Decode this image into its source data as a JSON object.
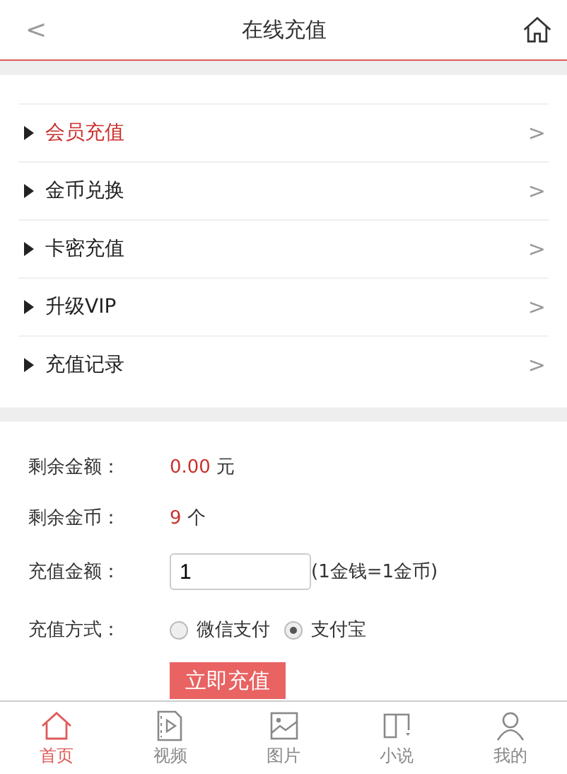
{
  "header": {
    "back": "<",
    "title": "在线充值"
  },
  "menu": [
    {
      "label": "会员充值",
      "selected": true,
      "chevron": ">"
    },
    {
      "label": "金币兑换",
      "selected": false,
      "chevron": ">"
    },
    {
      "label": "卡密充值",
      "selected": false,
      "chevron": ">"
    },
    {
      "label": "升级VIP",
      "selected": false,
      "chevron": ">"
    },
    {
      "label": "充值记录",
      "selected": false,
      "chevron": ">"
    }
  ],
  "balance": {
    "label": "剩余金额：",
    "value": "0.00",
    "unit": "元"
  },
  "coins": {
    "label": "剩余金币：",
    "value": "9",
    "unit": "个"
  },
  "amount": {
    "label": "充值金额：",
    "value": "1",
    "note": "(1金钱=1金币)"
  },
  "method": {
    "label": "充值方式：",
    "options": [
      {
        "label": "微信支付",
        "selected": false
      },
      {
        "label": "支付宝",
        "selected": true
      }
    ]
  },
  "submit": "立即充值",
  "nav": [
    {
      "kind": "home",
      "label": "首页",
      "selected": true
    },
    {
      "kind": "video",
      "label": "视频",
      "selected": false
    },
    {
      "kind": "image",
      "label": "图片",
      "selected": false
    },
    {
      "kind": "book",
      "label": "小说",
      "selected": false
    },
    {
      "kind": "user",
      "label": "我的",
      "selected": false
    }
  ]
}
